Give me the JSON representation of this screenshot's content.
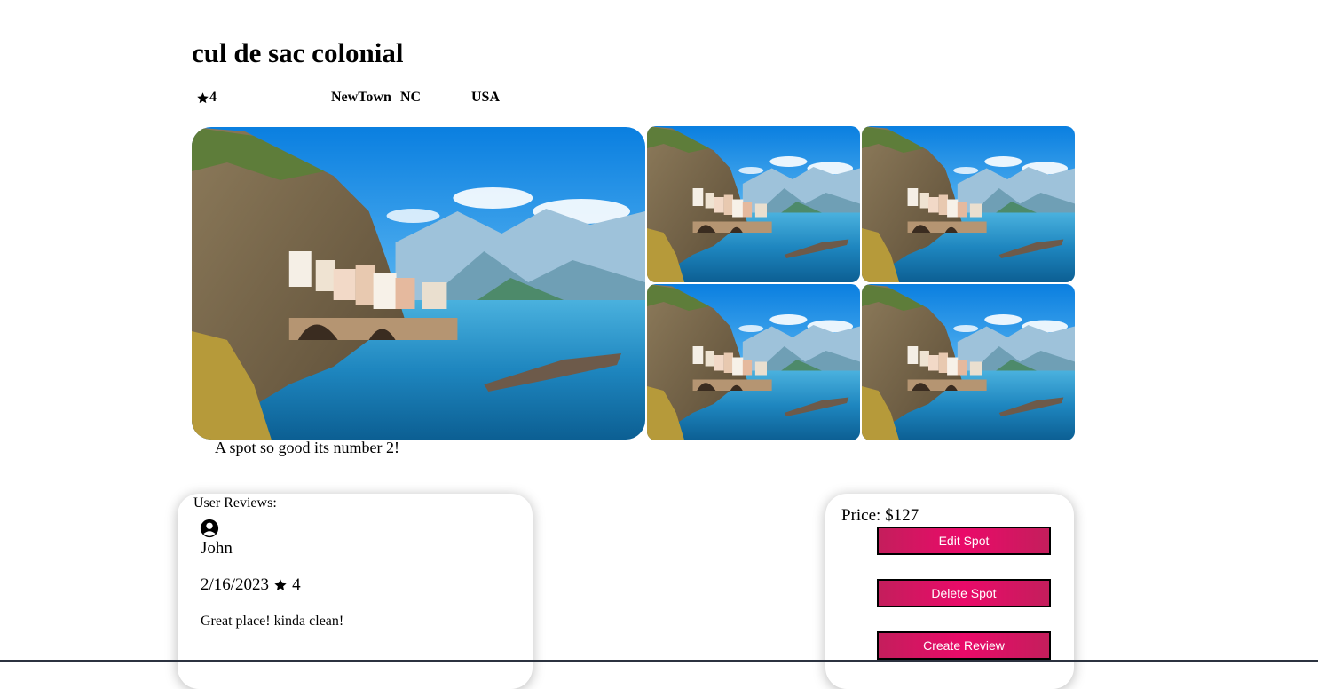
{
  "spot": {
    "name": "cul de sac colonial",
    "rating": "4",
    "city": "NewTown",
    "state": "NC",
    "country": "USA",
    "description": "A spot so good its number 2!"
  },
  "reviews": {
    "heading": "User Reviews:",
    "items": [
      {
        "user": "John",
        "date": "2/16/2023",
        "rating": "4",
        "text": "Great place! kinda clean!"
      }
    ]
  },
  "booking": {
    "price": "Price: $127",
    "edit_label": "Edit Spot",
    "delete_label": "Delete Spot",
    "review_label": "Create Review"
  },
  "icons": {
    "star": "star-icon",
    "avatar": "user-circle-icon"
  },
  "colors": {
    "button_gradient_edge": "#c41e5c",
    "button_gradient_center": "#ea0a69",
    "button_text": "#ffffff"
  }
}
